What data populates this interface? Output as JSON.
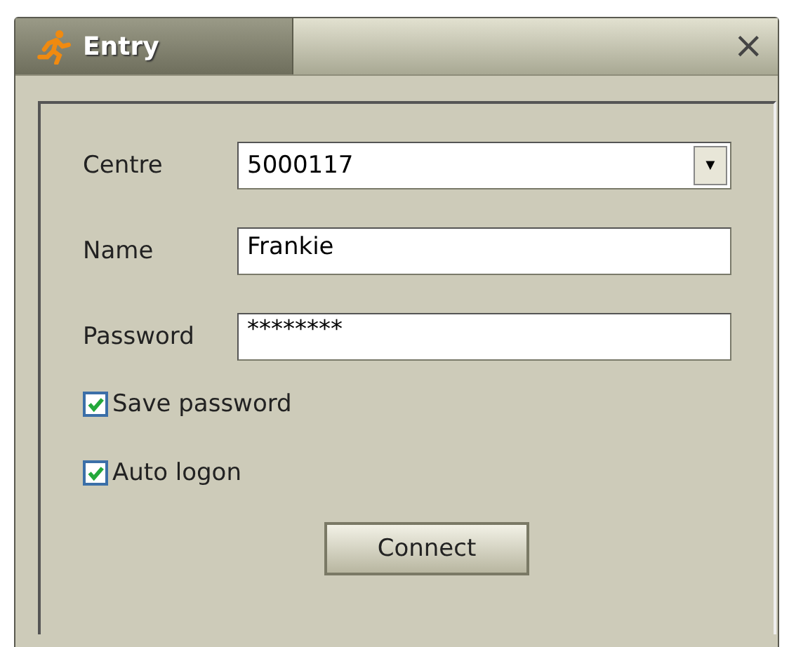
{
  "window": {
    "title": "Entry",
    "close": "×"
  },
  "fields": [
    {
      "kind": "combo",
      "label": "Centre",
      "value": "5000117",
      "arrow": "▼"
    },
    {
      "kind": "text",
      "label": "Name",
      "value": "Frankie"
    },
    {
      "kind": "password",
      "label": "Password",
      "value": "********"
    }
  ],
  "checkboxes": [
    {
      "label": "Save password",
      "checked": true
    },
    {
      "label": "Auto logon",
      "checked": true
    }
  ],
  "buttons": [
    "Connect"
  ]
}
